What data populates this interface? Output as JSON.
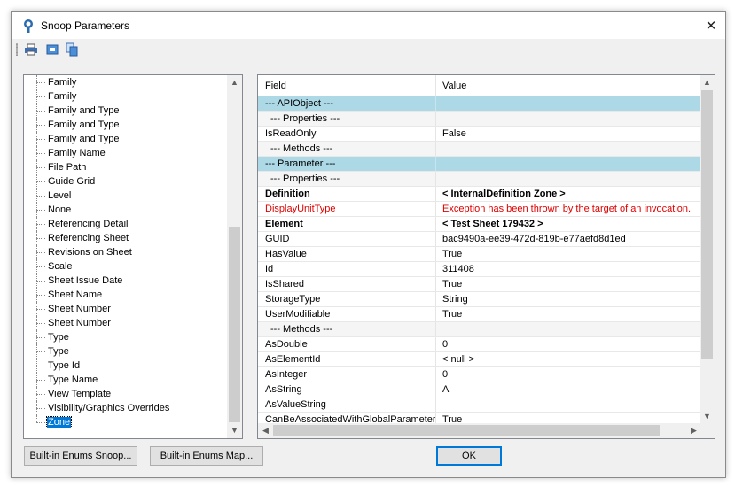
{
  "window": {
    "title": "Snoop Parameters",
    "close_glyph": "✕"
  },
  "toolbar": {
    "buttons": [
      {
        "icon": "printer-icon"
      },
      {
        "icon": "preview-icon"
      },
      {
        "icon": "copy-icon"
      }
    ]
  },
  "tree": {
    "items": [
      {
        "label": "Family"
      },
      {
        "label": "Family"
      },
      {
        "label": "Family and Type"
      },
      {
        "label": "Family and Type"
      },
      {
        "label": "Family and Type"
      },
      {
        "label": "Family Name"
      },
      {
        "label": "File Path"
      },
      {
        "label": "Guide Grid"
      },
      {
        "label": "Level"
      },
      {
        "label": "None"
      },
      {
        "label": "Referencing Detail"
      },
      {
        "label": "Referencing Sheet"
      },
      {
        "label": "Revisions on Sheet"
      },
      {
        "label": "Scale"
      },
      {
        "label": "Sheet Issue Date"
      },
      {
        "label": "Sheet Name"
      },
      {
        "label": "Sheet Number"
      },
      {
        "label": "Sheet Number"
      },
      {
        "label": "Type"
      },
      {
        "label": "Type"
      },
      {
        "label": "Type Id"
      },
      {
        "label": "Type Name"
      },
      {
        "label": "View Template"
      },
      {
        "label": "Visibility/Graphics Overrides"
      },
      {
        "label": "Zone",
        "selected": true
      }
    ]
  },
  "grid": {
    "headers": {
      "field": "Field",
      "value": "Value"
    },
    "rows": [
      {
        "field": "--- APIObject ---",
        "value": "",
        "kind": "section"
      },
      {
        "field": "--- Properties ---",
        "value": "",
        "kind": "sub"
      },
      {
        "field": "IsReadOnly",
        "value": "False",
        "kind": "normal"
      },
      {
        "field": "--- Methods ---",
        "value": "",
        "kind": "sub"
      },
      {
        "field": "--- Parameter ---",
        "value": "",
        "kind": "section"
      },
      {
        "field": "--- Properties ---",
        "value": "",
        "kind": "sub"
      },
      {
        "field": "Definition",
        "value": "< InternalDefinition  Zone >",
        "kind": "bold"
      },
      {
        "field": "DisplayUnitType",
        "value": "Exception has been thrown by the target of an invocation.",
        "kind": "error"
      },
      {
        "field": "Element",
        "value": "< Test Sheet  179432 >",
        "kind": "bold"
      },
      {
        "field": "GUID",
        "value": "bac9490a-ee39-472d-819b-e77aefd8d1ed",
        "kind": "normal"
      },
      {
        "field": "HasValue",
        "value": "True",
        "kind": "normal"
      },
      {
        "field": "Id",
        "value": "311408",
        "kind": "normal"
      },
      {
        "field": "IsShared",
        "value": "True",
        "kind": "normal"
      },
      {
        "field": "StorageType",
        "value": "String",
        "kind": "normal"
      },
      {
        "field": "UserModifiable",
        "value": "True",
        "kind": "normal"
      },
      {
        "field": "--- Methods ---",
        "value": "",
        "kind": "sub"
      },
      {
        "field": "AsDouble",
        "value": "0",
        "kind": "normal"
      },
      {
        "field": "AsElementId",
        "value": "< null >",
        "kind": "normal"
      },
      {
        "field": "AsInteger",
        "value": "0",
        "kind": "normal"
      },
      {
        "field": "AsString",
        "value": "A",
        "kind": "normal"
      },
      {
        "field": "AsValueString",
        "value": "",
        "kind": "normal"
      },
      {
        "field": "CanBeAssociatedWithGlobalParameters",
        "value": "True",
        "kind": "normal"
      }
    ]
  },
  "buttons": {
    "enums_snoop": "Built-in Enums Snoop...",
    "enums_map": "Built-in Enums Map...",
    "ok": "OK"
  },
  "colors": {
    "section_bg": "#add8e6",
    "error_text": "#e00000",
    "selection": "#0078d7"
  }
}
